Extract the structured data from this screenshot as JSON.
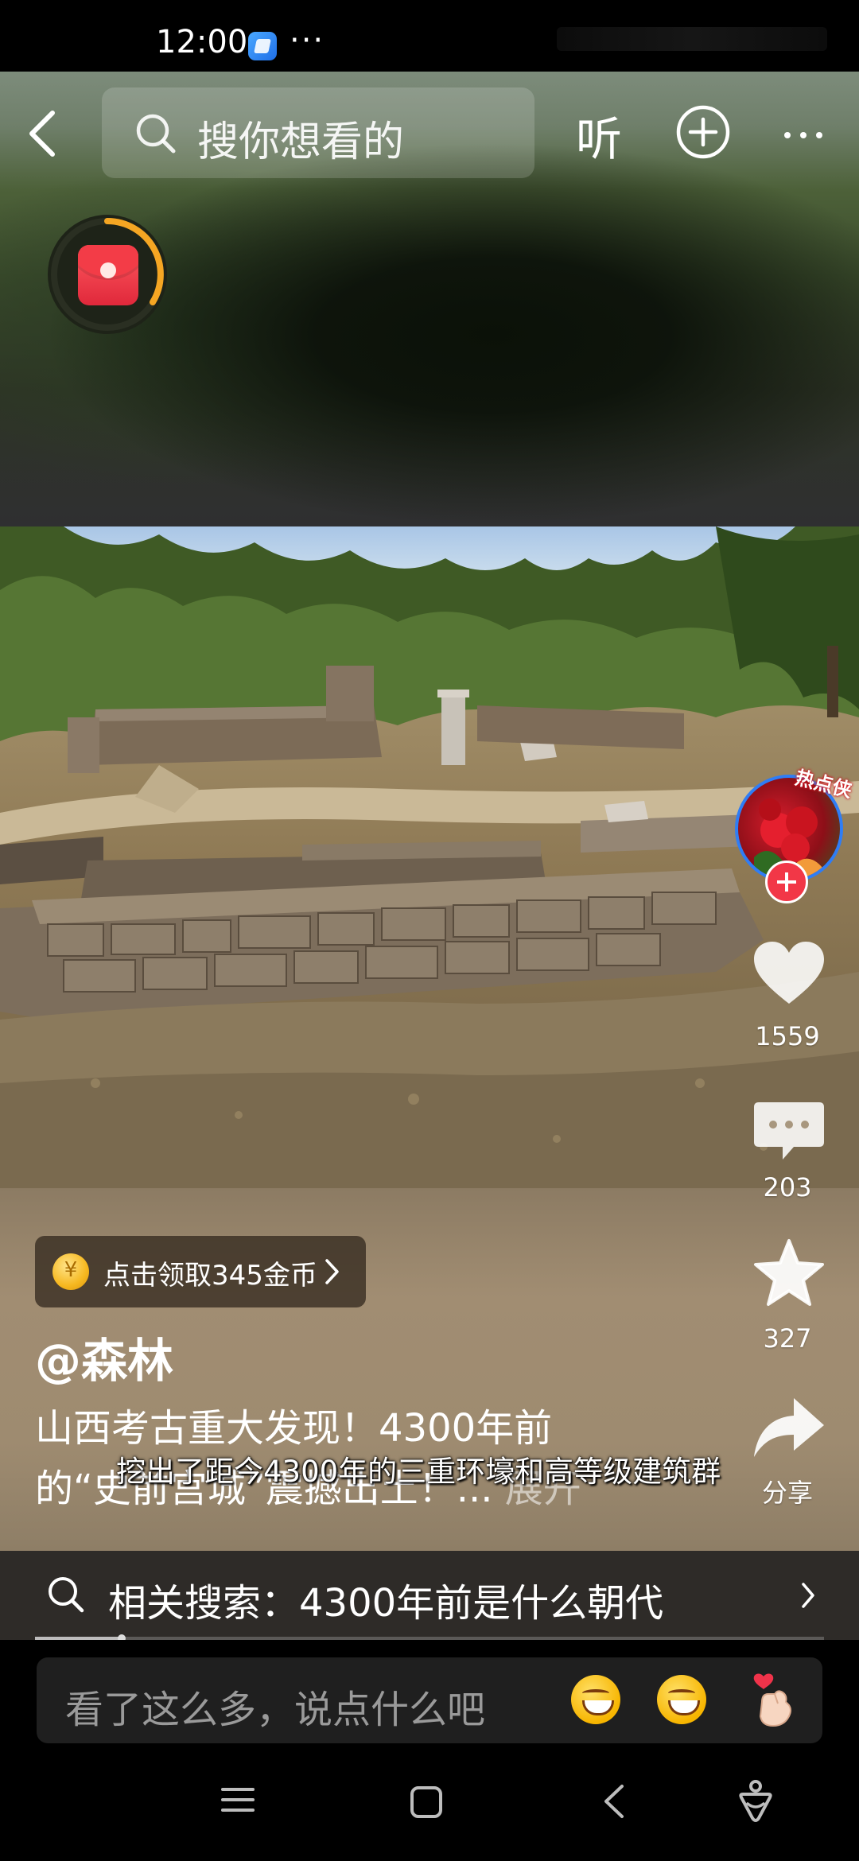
{
  "status_bar": {
    "time": "12:00",
    "more": "···"
  },
  "top_nav": {
    "search_placeholder": "搜你想看的",
    "listen_label": "听"
  },
  "coin_banner": {
    "text": "点击领取345金币",
    "coin_symbol": "¥"
  },
  "post": {
    "author": "@森林",
    "caption_line1": "山西考古重大发现！4300年前",
    "caption_line2": "的“史前宫城”震撼出土！...",
    "expand": "展开",
    "subtitle": "挖出了距今4300年的三重环壕和高等级建筑群"
  },
  "rail": {
    "avatar_badge": "热点侠",
    "likes": "1559",
    "comments": "203",
    "favorites": "327",
    "share_label": "分享"
  },
  "related_search": {
    "text": "相关搜索：4300年前是什么朝代"
  },
  "progress": {
    "fraction": 0.11
  },
  "comment_bar": {
    "placeholder": "看了这么多，说点什么吧"
  },
  "colors": {
    "like_red": "#f23747",
    "avatar_ring": "#2f7df5",
    "coin_gold": "#f6b820",
    "timer_ring": "#f5a623"
  }
}
